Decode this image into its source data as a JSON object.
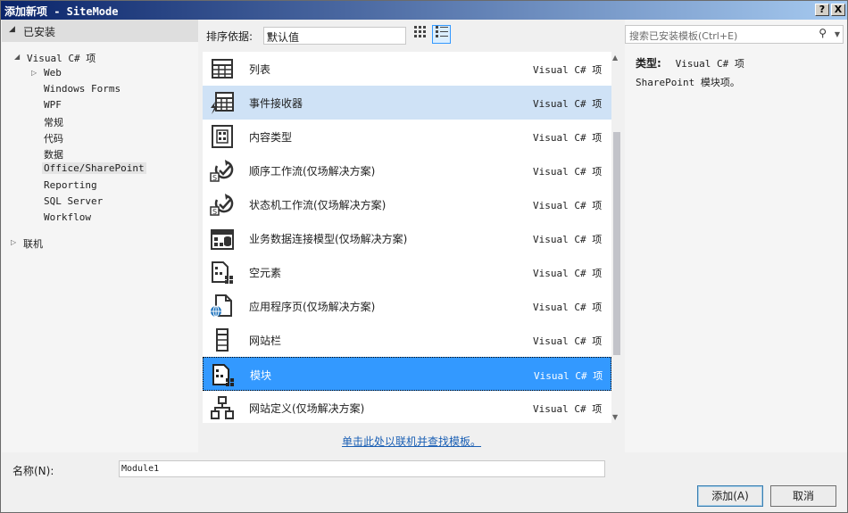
{
  "window": {
    "title": "添加新项 - SiteMode",
    "help_btn": "?",
    "close_btn": "X"
  },
  "left": {
    "installed": "已安装",
    "tree": [
      {
        "label": "Visual C# 项"
      },
      {
        "label": "Web"
      },
      {
        "label": "Windows Forms"
      },
      {
        "label": "WPF"
      },
      {
        "label": "常规"
      },
      {
        "label": "代码"
      },
      {
        "label": "数据"
      },
      {
        "label": "Office/SharePoint"
      },
      {
        "label": "Reporting"
      },
      {
        "label": "SQL Server"
      },
      {
        "label": "Workflow"
      },
      {
        "label": "联机"
      }
    ]
  },
  "center": {
    "sort_label": "排序依据:",
    "sort_value": "默认值",
    "items": [
      {
        "name": "列表",
        "type": "Visual C# 项",
        "icon": "list-icon"
      },
      {
        "name": "事件接收器",
        "type": "Visual C# 项",
        "icon": "event-receiver-icon"
      },
      {
        "name": "内容类型",
        "type": "Visual C# 项",
        "icon": "content-type-icon"
      },
      {
        "name": "顺序工作流(仅场解决方案)",
        "type": "Visual C# 项",
        "icon": "workflow-icon"
      },
      {
        "name": "状态机工作流(仅场解决方案)",
        "type": "Visual C# 项",
        "icon": "workflow-icon"
      },
      {
        "name": "业务数据连接模型(仅场解决方案)",
        "type": "Visual C# 项",
        "icon": "bdc-model-icon"
      },
      {
        "name": "空元素",
        "type": "Visual C# 项",
        "icon": "empty-element-icon"
      },
      {
        "name": "应用程序页(仅场解决方案)",
        "type": "Visual C# 项",
        "icon": "application-page-icon"
      },
      {
        "name": "网站栏",
        "type": "Visual C# 项",
        "icon": "site-column-icon"
      },
      {
        "name": "模块",
        "type": "Visual C# 项",
        "icon": "module-icon"
      },
      {
        "name": "网站定义(仅场解决方案)",
        "type": "Visual C# 项",
        "icon": "site-definition-icon"
      }
    ],
    "online_link": "单击此处以联机并查找模板。"
  },
  "right": {
    "search_placeholder": "搜索已安装模板(Ctrl+E)",
    "type_label": "类型:",
    "type_value": "Visual C# 项",
    "description": "SharePoint 模块项。"
  },
  "bottom": {
    "name_label": "名称(N):",
    "name_value": "Module1",
    "add_button": "添加(A)",
    "cancel_button": "取消"
  }
}
